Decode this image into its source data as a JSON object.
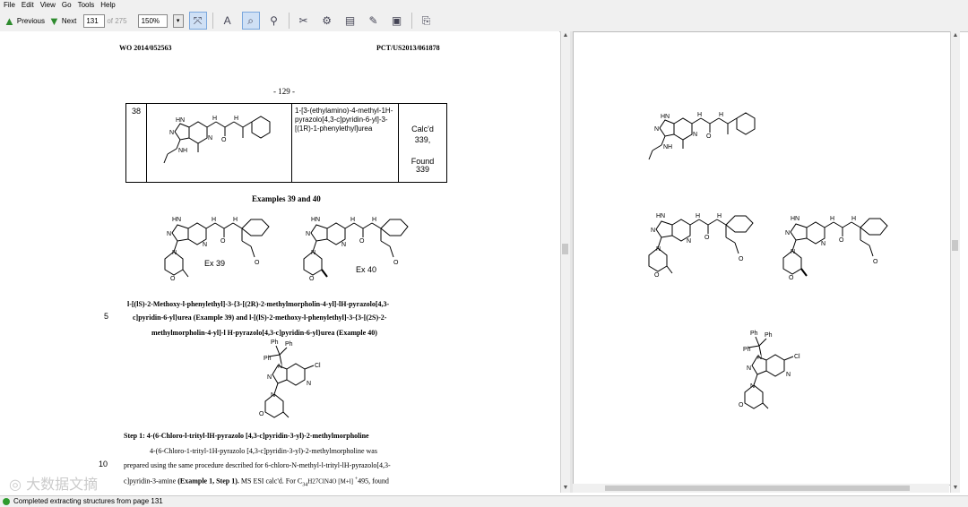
{
  "menu": [
    "File",
    "Edit",
    "View",
    "Go",
    "Tools",
    "Help"
  ],
  "toolbar": {
    "previous_label": "Previous",
    "next_label": "Next",
    "page_value": "131",
    "page_count": "of 275",
    "zoom_value": "150%"
  },
  "document": {
    "header_left": "WO 2014/052563",
    "header_right": "PCT/US2013/061878",
    "page_number": "- 129 -",
    "table": {
      "number": "38",
      "name": "1-[3-(ethylamino)-4-methyl-1H-pyrazolo[4,3-c]pyridin-6-yl]-3-[(1R)-1-phenylethyl]urea",
      "calcd": "Calc'd",
      "calcd_value": "339,",
      "found": "Found",
      "found_value": "339"
    },
    "examples_heading": "Examples 39 and 40",
    "ex39_label": "Ex 39",
    "ex40_label": "Ex 40",
    "para_line1": "l-[(lS)-2-Methoxy-l-phenylethyl]-3-{3-[(2R)-2-methylmorpholin-4-yl]-lH-pyrazolo[4,3-",
    "para_line2": "c]pyridin-6-yl}urea (Example 39) and l-[(lS)-2-methoxy-l-phenylethyl]-3-{3-[(2S)-2-",
    "para_line3": "methylmorpholin-4-yl]-l H-pyrazolo[4,3-c]pyridin-6-yl}urea (Example 40)",
    "line_number_5": "5",
    "line_number_10": "10",
    "step_heading": "Step 1: 4-(6-Chloro-l-trityl-lH-pyrazolo   [4,3-c]pyridin-3-yl)-2-methylmorpholine",
    "step_line1": "4-(6-Chloro-1-trityl-1H-pyrazolo [4,3-c]pyridin-3-yl)-2-methylmorpholine was",
    "step_line2": "prepared using the same procedure described for 6-chloro-N-methyl-l-trityl-lH-pyrazolo[4,3-",
    "step_line3_a": "c]pyridin-3-amine ",
    "step_line3_b": "(Example 1, Step 1).",
    "step_line3_c": " MS ESI calc'd. For C",
    "step_line3_d": "34",
    "step_line3_e": "H27ClN4O   [M+l] ",
    "step_line3_f": "+",
    "step_line3_g": "495, found"
  },
  "status": {
    "text": "Completed extracting structures from page 131"
  },
  "watermark": "大数据文摘"
}
